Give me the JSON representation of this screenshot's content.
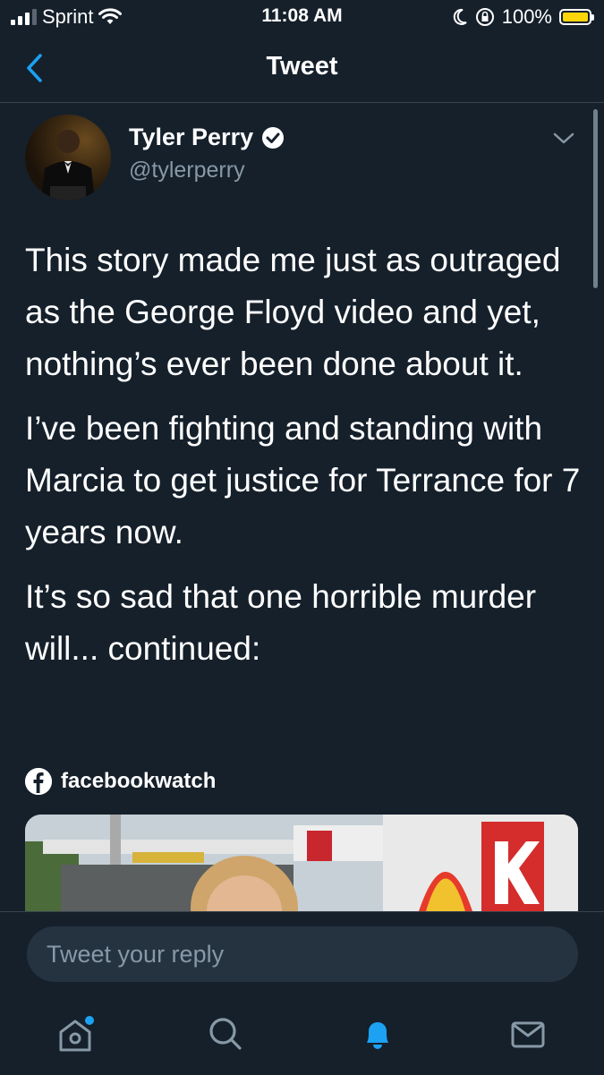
{
  "status_bar": {
    "carrier": "Sprint",
    "time": "11:08 AM",
    "battery": "100%"
  },
  "header": {
    "title": "Tweet"
  },
  "tweet": {
    "author_name": "Tyler Perry",
    "author_handle": "@tylerperry",
    "paragraphs": [
      "This story made me just as outraged as the George Floyd video and yet, nothing’s ever been done about it.",
      "I’ve been fighting and standing with Marcia to get justice for Terrance for 7 years now.",
      "It’s so sad that one horrible murder will... continued:"
    ]
  },
  "card": {
    "source": "facebookwatch"
  },
  "reply": {
    "placeholder": "Tweet your reply"
  },
  "colors": {
    "background": "#15202b",
    "accent": "#1da1f2",
    "muted": "#8899a6"
  }
}
